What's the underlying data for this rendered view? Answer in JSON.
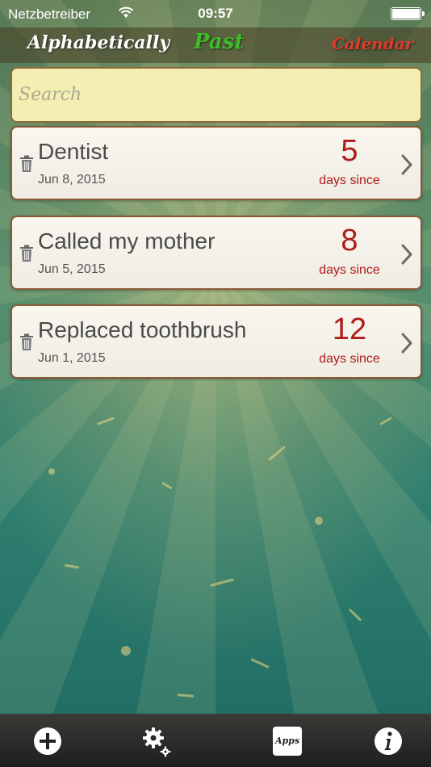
{
  "status_bar": {
    "carrier": "Netzbetreiber",
    "time": "09:57"
  },
  "tabs": [
    {
      "label": "Alphabetically",
      "color": "#ffffff"
    },
    {
      "label": "Past",
      "color": "#3dbb2a",
      "selected": true
    },
    {
      "label": "Calendar",
      "color": "#e23a2a"
    }
  ],
  "search": {
    "placeholder": "Search",
    "value": ""
  },
  "events": [
    {
      "title": "Dentist",
      "date": "Jun 8, 2015",
      "count": "5",
      "unit": "days since"
    },
    {
      "title": "Called my mother",
      "date": "Jun 5, 2015",
      "count": "8",
      "unit": "days since"
    },
    {
      "title": "Replaced toothbrush",
      "date": "Jun 1, 2015",
      "count": "12",
      "unit": "days since"
    }
  ],
  "toolbar": {
    "apps_label": "Apps",
    "icons": [
      "plus-icon",
      "settings-icon",
      "apps-icon",
      "info-icon"
    ]
  },
  "colors": {
    "accent_red": "#b01b1b",
    "tab_past_green": "#3dbb2a",
    "tab_calendar_red": "#e23a2a"
  }
}
